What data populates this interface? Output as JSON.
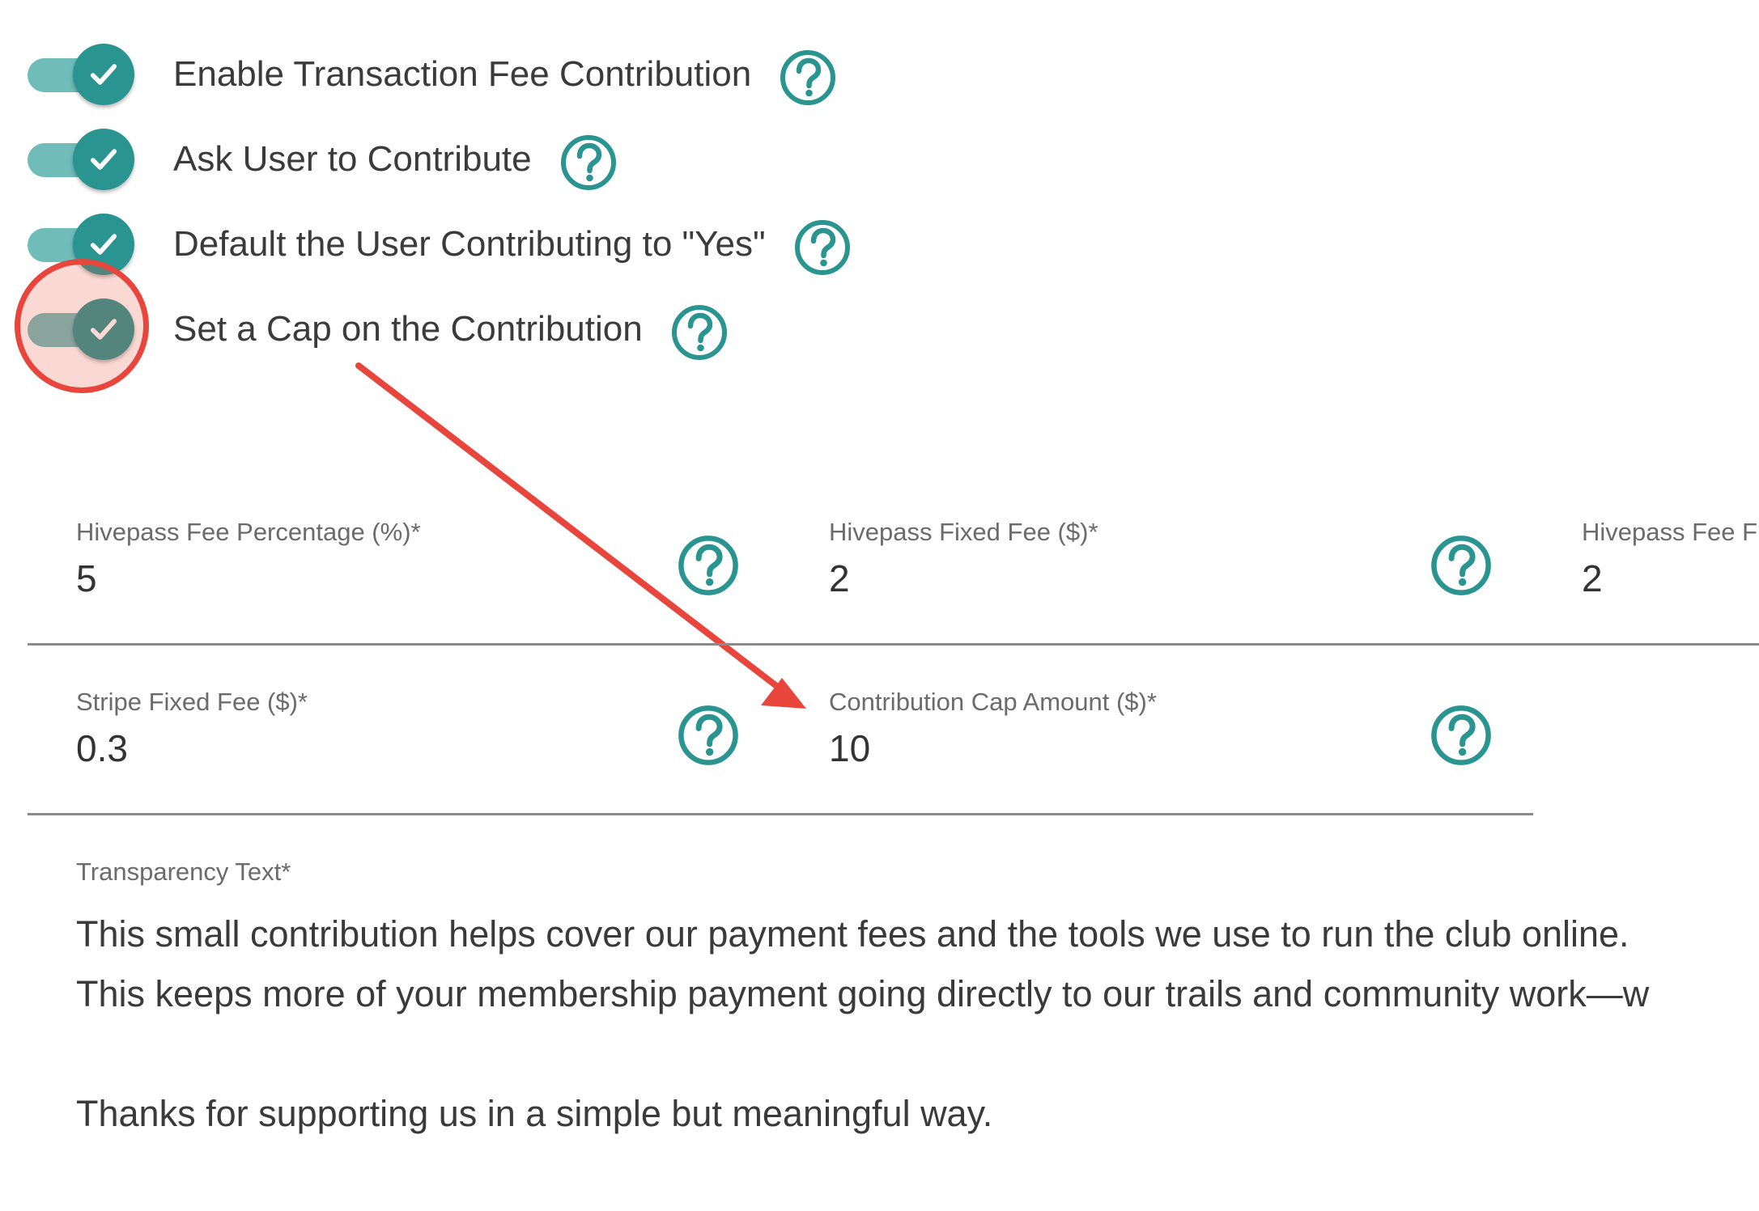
{
  "toggles": [
    {
      "label": "Enable Transaction Fee Contribution",
      "checked": true
    },
    {
      "label": "Ask User to Contribute",
      "checked": true
    },
    {
      "label": "Default the User Contributing to \"Yes\"",
      "checked": true
    },
    {
      "label": "Set a Cap on the Contribution",
      "checked": true
    }
  ],
  "fields": {
    "hivepass_fee_percentage": {
      "label": "Hivepass Fee Percentage (%)*",
      "value": "5"
    },
    "hivepass_fixed_fee": {
      "label": "Hivepass Fixed Fee ($)*",
      "value": "2"
    },
    "hivepass_fee_third": {
      "label": "Hivepass Fee F",
      "value": "2"
    },
    "stripe_fixed_fee": {
      "label": "Stripe Fixed Fee ($)*",
      "value": "0.3"
    },
    "contribution_cap_amount": {
      "label": "Contribution Cap Amount ($)*",
      "value": "10"
    }
  },
  "transparency": {
    "label": "Transparency Text*",
    "lines": [
      "This small contribution helps cover our payment fees and the tools we use to run the club online.",
      "This keeps more of your membership payment going directly to our trails and community work—w",
      "",
      "Thanks for supporting us in a simple but meaningful way."
    ]
  },
  "icons": {
    "help": "help-circle-icon",
    "check": "check-icon"
  },
  "colors": {
    "accent": "#2a9490",
    "track": "#6fbcb9",
    "annotation": "#e8453c"
  }
}
